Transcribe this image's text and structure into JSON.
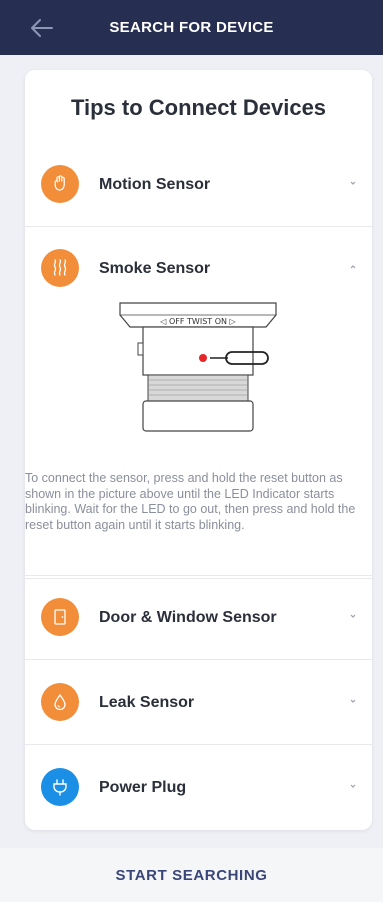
{
  "header": {
    "title": "SEARCH FOR DEVICE",
    "back_icon": "arrow-left-icon"
  },
  "card": {
    "title": "Tips to Connect Devices",
    "items": [
      {
        "label": "Motion Sensor",
        "icon": "hand-icon",
        "color": "#f28e3a",
        "expanded": false
      },
      {
        "label": "Smoke Sensor",
        "icon": "smoke-icon",
        "color": "#f28e3a",
        "expanded": true,
        "illustration_text": "◁ OFF TWIST ON ▷",
        "description": "To connect the sensor, press and hold the reset button as shown in the picture above until the LED Indicator starts blinking. Wait for the LED to go out, then press and hold the reset button again until it starts blinking."
      },
      {
        "label": "Door & Window Sensor",
        "icon": "door-icon",
        "color": "#f28e3a",
        "expanded": false
      },
      {
        "label": "Leak Sensor",
        "icon": "droplet-icon",
        "color": "#f28e3a",
        "expanded": false
      },
      {
        "label": "Power Plug",
        "icon": "plug-icon",
        "color": "#1b8fe6",
        "expanded": false
      }
    ]
  },
  "footer": {
    "start_label": "START SEARCHING"
  },
  "colors": {
    "topbar": "#262f52",
    "accent_orange": "#f28e3a",
    "accent_blue": "#1b8fe6",
    "link": "#3b4678"
  }
}
